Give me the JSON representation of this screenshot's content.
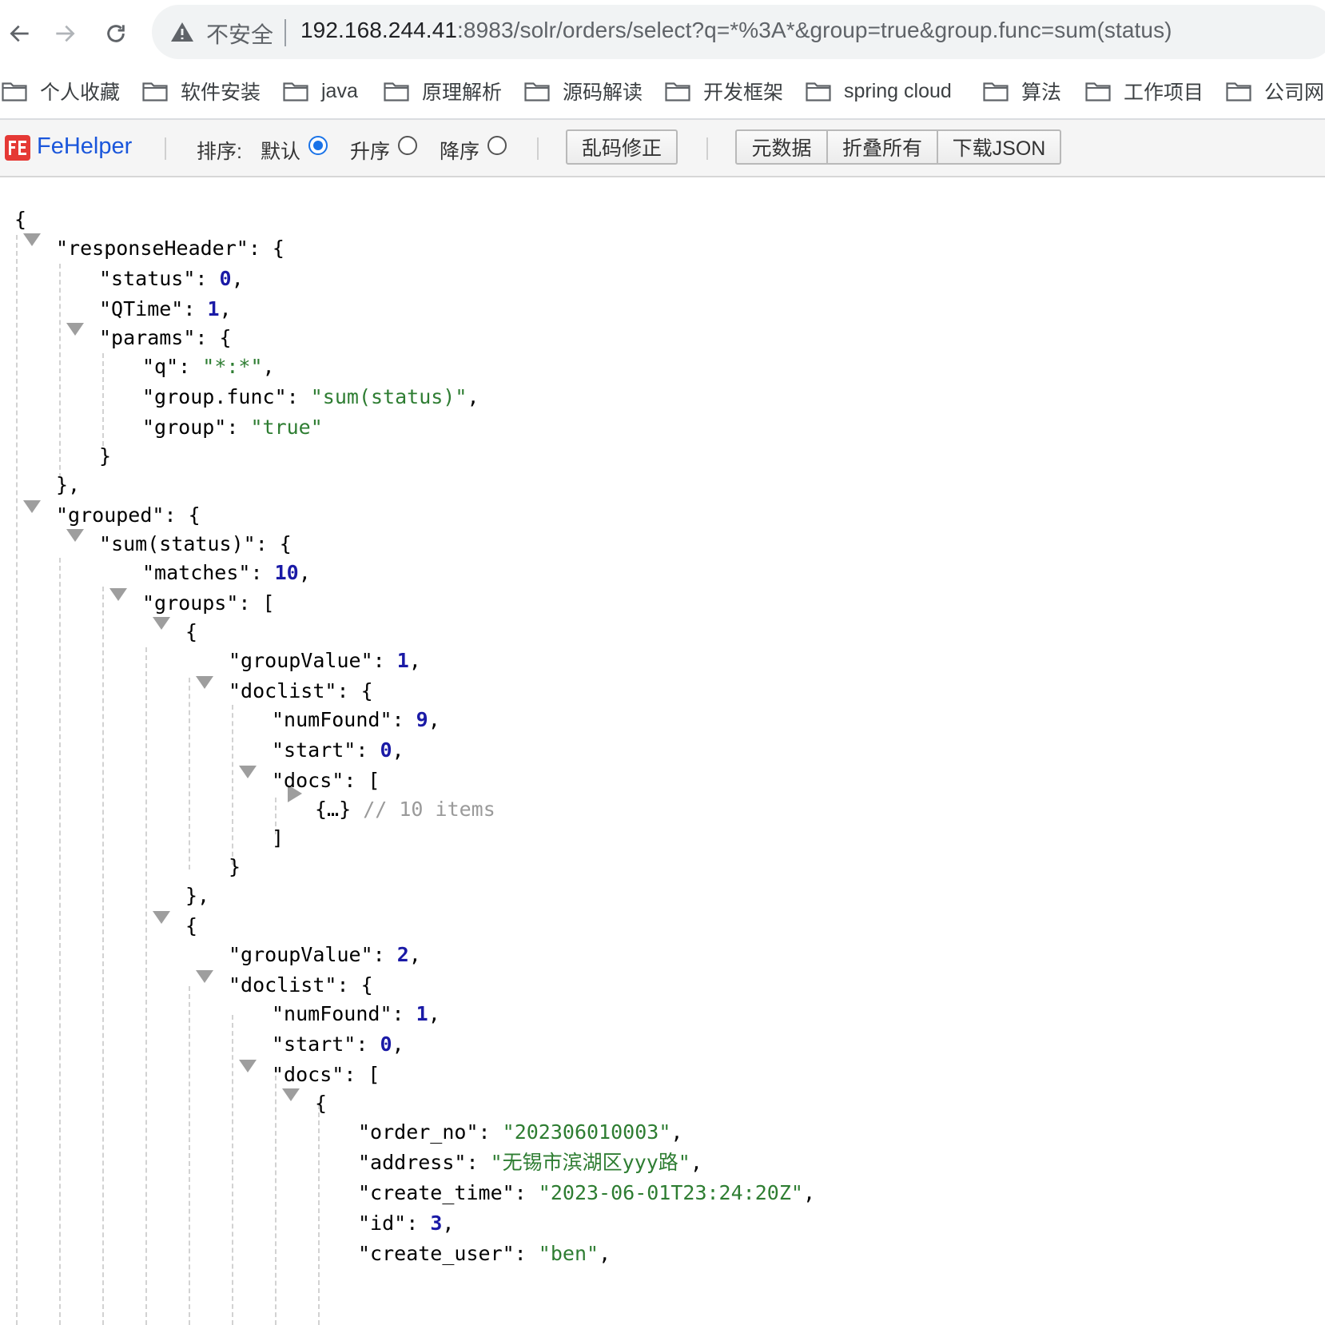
{
  "browser": {
    "security_label": "不安全",
    "url_host": "192.168.244.41",
    "url_path": ":8983/solr/orders/select?q=*%3A*&group=true&group.func=sum(status)"
  },
  "bookmarks": [
    {
      "label": "个人收藏"
    },
    {
      "label": "软件安装"
    },
    {
      "label": "java"
    },
    {
      "label": "原理解析"
    },
    {
      "label": "源码解读"
    },
    {
      "label": "开发框架"
    },
    {
      "label": "spring cloud"
    },
    {
      "label": "算法"
    },
    {
      "label": "工作项目"
    },
    {
      "label": "公司网站"
    }
  ],
  "fehelper": {
    "name": "FeHelper",
    "sort_label": "排序:",
    "sort_options": [
      {
        "label": "默认",
        "checked": true
      },
      {
        "label": "升序",
        "checked": false
      },
      {
        "label": "降序",
        "checked": false
      }
    ],
    "fix_encoding": "乱码修正",
    "metadata": "元数据",
    "collapse_all": "折叠所有",
    "download_json": "下载JSON"
  },
  "json": {
    "responseHeader": {
      "status": 0,
      "QTime": 1,
      "params": {
        "q": "*:*",
        "group.func": "sum(status)",
        "group": "true"
      }
    },
    "grouped_key": "sum(status)",
    "matches": 10,
    "groups": [
      {
        "groupValue": 1,
        "numFound": 9,
        "start": 0,
        "collapsed_summary": "{…}",
        "collapsed_comment": "// 10 items"
      },
      {
        "groupValue": 2,
        "numFound": 1,
        "start": 0,
        "doc": {
          "order_no": "202306010003",
          "address": "无锡市滨湖区yyy路",
          "create_time": "2023-06-01T23:24:20Z",
          "id": 3,
          "create_user": "ben"
        }
      }
    ]
  },
  "colors": {
    "string": "#2e7d32",
    "number": "#1a1aa6",
    "accent": "#1a73e8",
    "brand": "#1a56db"
  }
}
